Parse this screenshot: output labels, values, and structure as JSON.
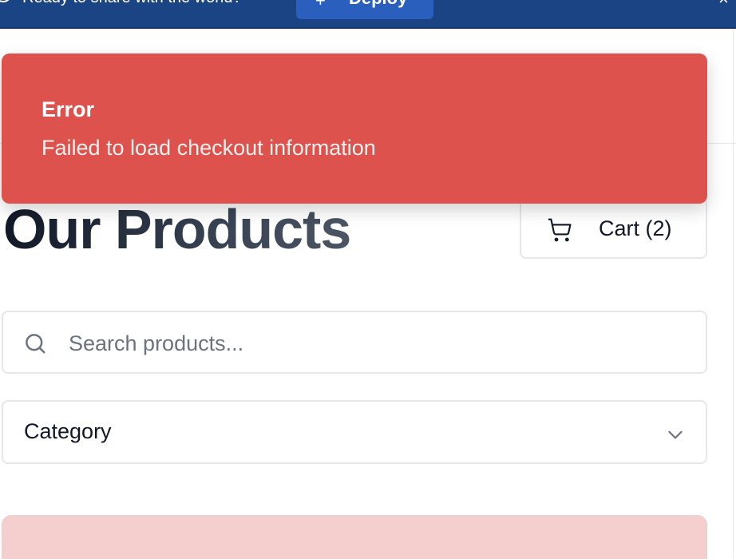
{
  "banner": {
    "text": "Ready to share with the world?",
    "deploy_label": "Deploy",
    "close_label": "×"
  },
  "toast": {
    "title": "Error",
    "message": "Failed to load checkout information"
  },
  "header": {
    "title": "Our Products",
    "cart_label": "Cart (2)"
  },
  "search": {
    "placeholder": "Search products...",
    "value": ""
  },
  "filters": {
    "category_label": "Category"
  },
  "colors": {
    "banner": "#1b4485",
    "deploy_button": "#2a5fbe",
    "toast_error": "#dd524d",
    "card_tint": "#f5cfcd"
  },
  "icons": {
    "banner_icon": "info-icon",
    "deploy_icon": "plus-icon",
    "close_icon": "close-icon",
    "cart_icon": "shopping-cart-icon",
    "search_icon": "search-icon",
    "dropdown_icon": "chevron-down-icon"
  }
}
